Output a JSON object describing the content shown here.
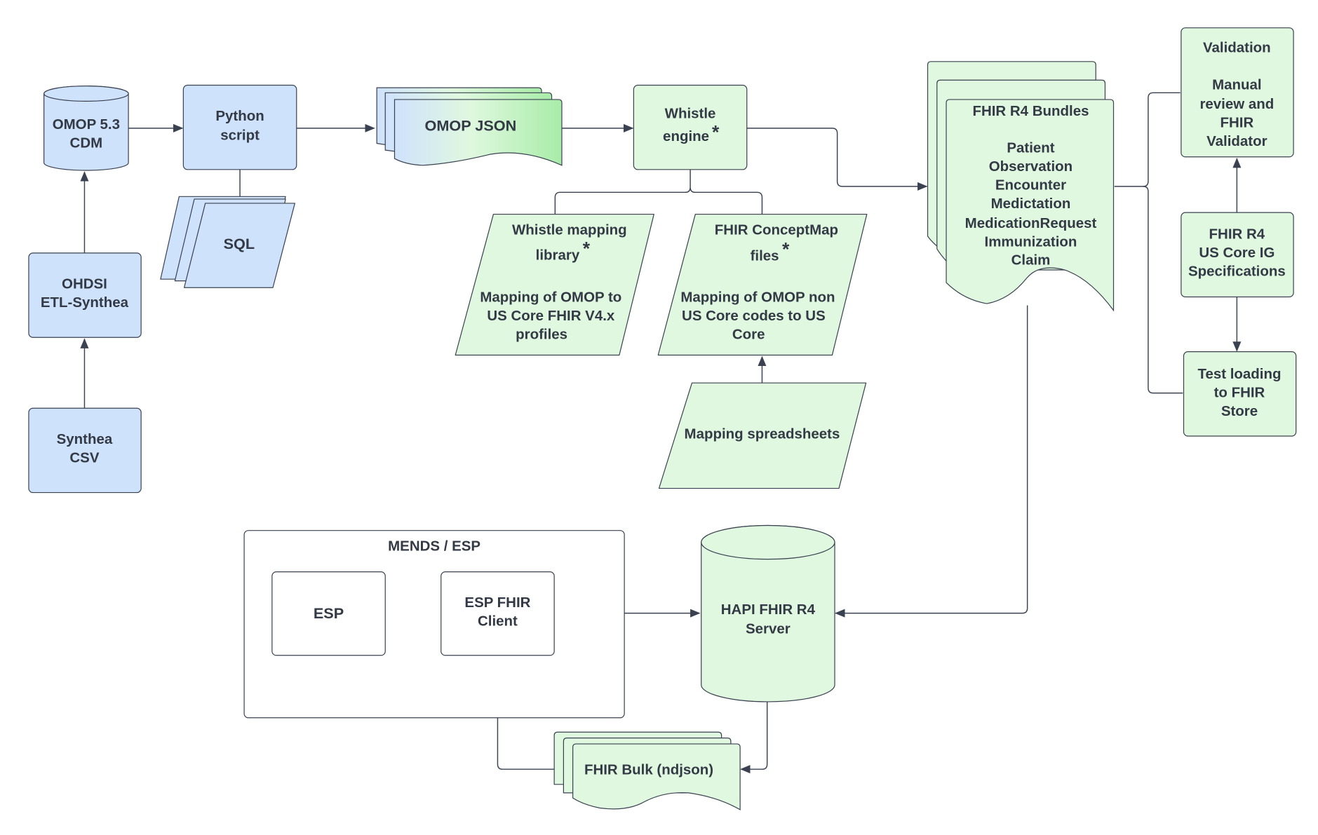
{
  "diagram": {
    "colors": {
      "blue_fill": "#cfe2fc",
      "green_fill": "#e0f8e0",
      "stroke": "#3a4150",
      "text": "#333a45"
    },
    "nodes": {
      "omop_cdm": {
        "lines": [
          "OMOP 5.3",
          "CDM"
        ],
        "shape": "cylinder"
      },
      "python_script": {
        "lines": [
          "Python",
          "script"
        ],
        "shape": "rectangle"
      },
      "sql": {
        "lines": [
          "SQL"
        ],
        "shape": "stacked-parallelogram"
      },
      "ohdsi_etl": {
        "lines": [
          "OHDSI",
          "ETL-Synthea"
        ],
        "shape": "rectangle"
      },
      "synthea_csv": {
        "lines": [
          "Synthea",
          "CSV"
        ],
        "shape": "rectangle"
      },
      "omop_json": {
        "lines": [
          "OMOP JSON"
        ],
        "shape": "stacked-document"
      },
      "whistle_engine": {
        "lines": [
          "Whistle",
          "engine"
        ],
        "asterisk": "*",
        "shape": "rectangle"
      },
      "whistle_library": {
        "title": [
          "Whistle mapping",
          "library"
        ],
        "asterisk": "*",
        "lines": [
          "Mapping of OMOP to",
          "US Core FHIR V4.x",
          "profiles"
        ],
        "shape": "parallelogram"
      },
      "conceptmap_files": {
        "title": [
          "FHIR ConceptMap",
          "files"
        ],
        "asterisk": "*",
        "lines": [
          "Mapping of OMOP non",
          "US Core codes to US",
          "Core"
        ],
        "shape": "parallelogram"
      },
      "mapping_spreadsheets": {
        "lines": [
          "Mapping spreadsheets"
        ],
        "shape": "parallelogram"
      },
      "fhir_bundles": {
        "title": "FHIR R4 Bundles",
        "lines": [
          "Patient",
          "Observation",
          "Encounter",
          "Medictation",
          "MedicationRequest",
          "Immunization",
          "Claim"
        ],
        "shape": "stacked-document"
      },
      "validation": {
        "title": "Validation",
        "lines": [
          "Manual",
          "review and",
          "FHIR",
          "Validator"
        ],
        "shape": "rectangle"
      },
      "us_core_ig": {
        "lines": [
          "FHIR R4",
          "US Core IG",
          "Specifications"
        ],
        "shape": "rectangle"
      },
      "test_loading": {
        "lines": [
          "Test loading",
          "to FHIR",
          "Store"
        ],
        "shape": "rectangle"
      },
      "mends_esp": {
        "title": "MENDS / ESP",
        "shape": "container"
      },
      "esp": {
        "lines": [
          "ESP"
        ],
        "shape": "rectangle"
      },
      "esp_fhir_client": {
        "lines": [
          "ESP FHIR",
          "Client"
        ],
        "shape": "rectangle"
      },
      "hapi_server": {
        "lines": [
          "HAPI FHIR R4",
          "Server"
        ],
        "shape": "cylinder"
      },
      "fhir_bulk": {
        "lines": [
          "FHIR Bulk (ndjson)"
        ],
        "shape": "stacked-document"
      }
    }
  }
}
